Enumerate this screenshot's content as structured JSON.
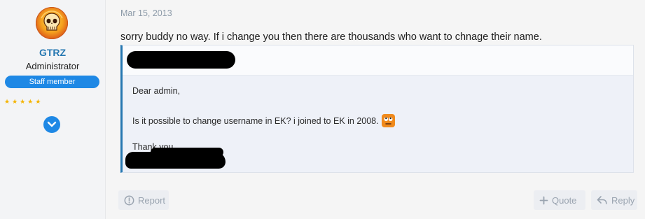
{
  "user": {
    "name": "GTRZ",
    "title": "Administrator",
    "badge": "Staff member",
    "star_count": 5
  },
  "post": {
    "date": "Mar 15, 2013",
    "text": "sorry buddy no way. If i change you then there are thousands who want to chnage their name.",
    "quote": {
      "line1": "Dear admin,",
      "line2": "Is it possible to change username in EK? i joined to EK in 2008.",
      "line3": "Thank you"
    }
  },
  "actions": {
    "report": "Report",
    "quote": "Quote",
    "reply": "Reply"
  },
  "icons": {
    "avatar": "flaming-skull-avatar",
    "expand": "chevron-down-icon",
    "emoji": "eye-roll-emoji-icon",
    "report": "alert-circle-icon",
    "quote": "plus-icon",
    "reply": "reply-arrow-icon"
  },
  "colors": {
    "accent": "#2577b1",
    "badge": "#1e88e5",
    "star": "#f4b400",
    "quote_border": "#2577b1"
  }
}
